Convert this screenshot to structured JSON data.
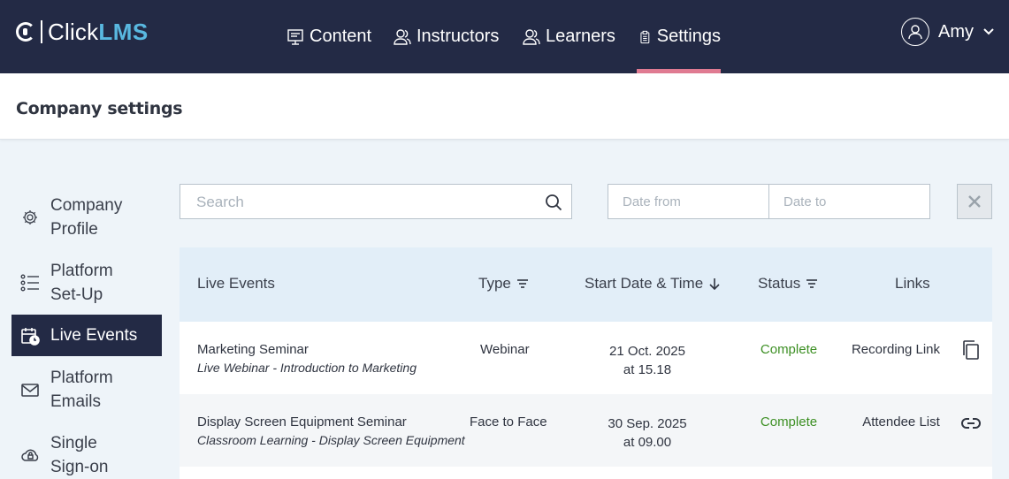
{
  "brand": {
    "click": "Click",
    "lms": "LMS"
  },
  "nav": {
    "content": "Content",
    "instructors": "Instructors",
    "learners": "Learners",
    "settings": "Settings"
  },
  "user": {
    "name": "Amy"
  },
  "page": {
    "title": "Company settings"
  },
  "sidebar": {
    "items": [
      {
        "label": "Company Profile",
        "icon": "gear-icon"
      },
      {
        "label": "Platform Set-Up",
        "icon": "list-icon"
      },
      {
        "label": "Live Events",
        "icon": "calendar-clock-icon",
        "active": true
      },
      {
        "label": "Platform Emails",
        "icon": "envelope-icon"
      },
      {
        "label": "Single Sign-on",
        "icon": "cloud-lock-icon"
      }
    ]
  },
  "filters": {
    "search_placeholder": "Search",
    "date_from_placeholder": "Date from",
    "date_to_placeholder": "Date to"
  },
  "table": {
    "headers": {
      "events": "Live Events",
      "type": "Type",
      "start": "Start Date & Time",
      "status": "Status",
      "links": "Links"
    },
    "rows": [
      {
        "title": "Marketing Seminar",
        "subtitle": "Live Webinar - Introduction to Marketing",
        "type": "Webinar",
        "date": "21 Oct. 2025",
        "time": "at 15.18",
        "status": "Complete",
        "link": "Recording Link",
        "link_icon": "copy-icon"
      },
      {
        "title": "Display Screen Equipment Seminar",
        "subtitle": "Classroom Learning - Display Screen Equipment",
        "type": "Face to Face",
        "date": "30 Sep. 2025",
        "time": "at 09.00",
        "status": "Complete",
        "link": "Attendee List",
        "link_icon": "chain-link-icon"
      }
    ]
  },
  "colors": {
    "navbar": "#232a45",
    "brand_accent": "#59b8e0",
    "active_underline": "#e07b92",
    "status_complete": "#3c8f23",
    "table_header": "#e2eef8"
  }
}
